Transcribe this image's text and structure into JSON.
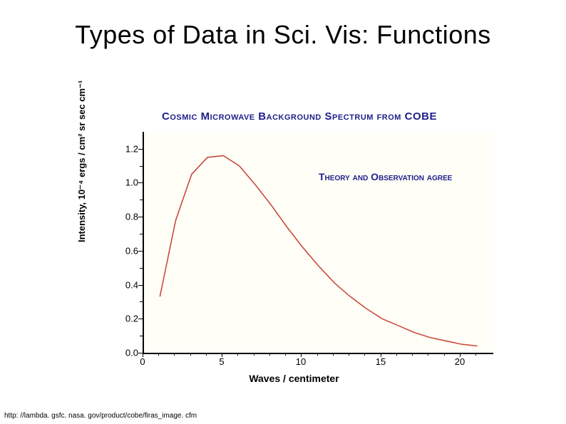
{
  "title": "Types of Data in Sci. Vis: Functions",
  "source": "http: //lambda. gsfc. nasa. gov/product/cobe/firas_image. cfm",
  "chart_data": {
    "type": "line",
    "title": "Cosmic Microwave Background Spectrum from COBE",
    "annotation": "Theory and Observation agree",
    "xlabel": "Waves / centimeter",
    "ylabel": "Intensity, 10⁻⁴ ergs / cm² sr sec cm⁻¹",
    "x_ticks": [
      "0",
      "5",
      "10",
      "15",
      "20"
    ],
    "y_ticks": [
      "0.0",
      "0.2",
      "0.4",
      "0.6",
      "0.8",
      "1.0",
      "1.2"
    ],
    "xlim": [
      0,
      22
    ],
    "ylim": [
      0.0,
      1.3
    ],
    "x": [
      1,
      2,
      3,
      4,
      5,
      6,
      7,
      8,
      9,
      10,
      11,
      12,
      13,
      14,
      15,
      16,
      17,
      18,
      19,
      20,
      21
    ],
    "values": [
      0.33,
      0.78,
      1.05,
      1.15,
      1.16,
      1.1,
      0.99,
      0.87,
      0.74,
      0.62,
      0.51,
      0.41,
      0.33,
      0.26,
      0.2,
      0.16,
      0.12,
      0.09,
      0.07,
      0.05,
      0.04
    ],
    "line_color": "#c94a3b"
  }
}
